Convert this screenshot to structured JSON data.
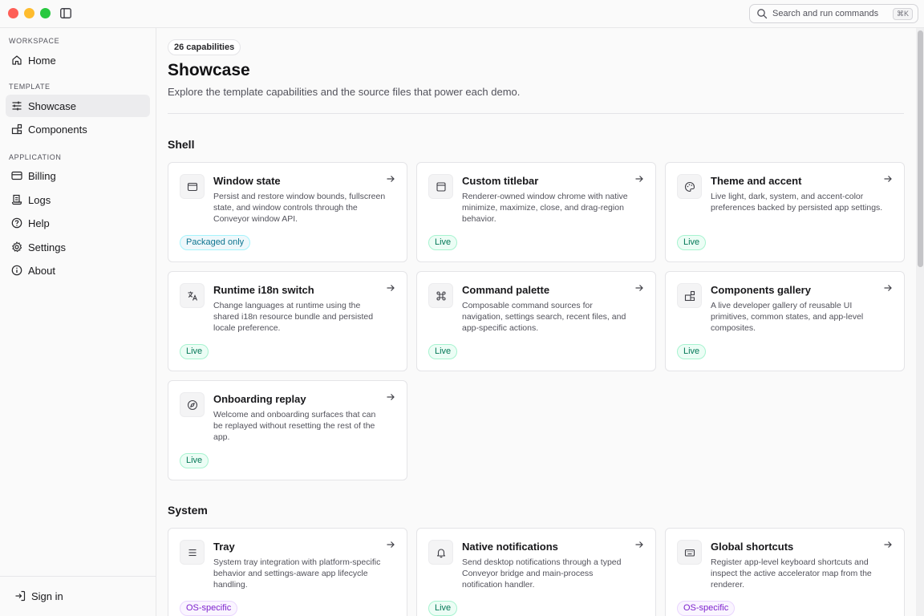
{
  "titlebar": {
    "search_placeholder": "Search and run commands",
    "search_shortcut": "⌘K"
  },
  "sidebar": {
    "sections": [
      {
        "label": "WORKSPACE"
      },
      {
        "label": "TEMPLATE"
      },
      {
        "label": "APPLICATION"
      }
    ],
    "items": [
      {
        "label": "Home",
        "icon": "home-icon"
      },
      {
        "label": "Showcase",
        "icon": "sliders-icon",
        "active": true
      },
      {
        "label": "Components",
        "icon": "blocks-icon"
      },
      {
        "label": "Billing",
        "icon": "credit-card-icon"
      },
      {
        "label": "Logs",
        "icon": "logs-icon"
      },
      {
        "label": "Help",
        "icon": "help-circle-icon"
      },
      {
        "label": "Settings",
        "icon": "gear-icon"
      },
      {
        "label": "About",
        "icon": "info-icon"
      }
    ],
    "footer": {
      "signin_label": "Sign in"
    }
  },
  "main": {
    "count_badge": "26 capabilities",
    "title": "Showcase",
    "subtitle": "Explore the template capabilities and the source files that power each demo.",
    "groups": [
      {
        "title": "Shell",
        "cards": [
          {
            "title": "Window state",
            "desc": "Persist and restore window bounds, fullscreen state, and window controls through the Conveyor window API.",
            "badge": "Packaged only",
            "badge_kind": "packaged",
            "icon": "window-icon"
          },
          {
            "title": "Custom titlebar",
            "desc": "Renderer-owned window chrome with native minimize, maximize, close, and drag-region behavior.",
            "badge": "Live",
            "badge_kind": "live",
            "icon": "titlebar-icon"
          },
          {
            "title": "Theme and accent",
            "desc": "Live light, dark, system, and accent-color preferences backed by persisted app settings.",
            "badge": "Live",
            "badge_kind": "live",
            "icon": "palette-icon"
          },
          {
            "title": "Runtime i18n switch",
            "desc": "Change languages at runtime using the shared i18n resource bundle and persisted locale preference.",
            "badge": "Live",
            "badge_kind": "live",
            "icon": "languages-icon"
          },
          {
            "title": "Command palette",
            "desc": "Composable command sources for navigation, settings search, recent files, and app-specific actions.",
            "badge": "Live",
            "badge_kind": "live",
            "icon": "command-icon"
          },
          {
            "title": "Components gallery",
            "desc": "A live developer gallery of reusable UI primitives, common states, and app-level composites.",
            "badge": "Live",
            "badge_kind": "live",
            "icon": "blocks-icon"
          },
          {
            "title": "Onboarding replay",
            "desc": "Welcome and onboarding surfaces that can be replayed without resetting the rest of the app.",
            "badge": "Live",
            "badge_kind": "live",
            "icon": "compass-icon"
          }
        ]
      },
      {
        "title": "System",
        "cards": [
          {
            "title": "Tray",
            "desc": "System tray integration with platform-specific behavior and settings-aware app lifecycle handling.",
            "badge": "OS-specific",
            "badge_kind": "os",
            "icon": "menu-lines-icon"
          },
          {
            "title": "Native notifications",
            "desc": "Send desktop notifications through a typed Conveyor bridge and main-process notification handler.",
            "badge": "Live",
            "badge_kind": "live",
            "icon": "bell-icon"
          },
          {
            "title": "Global shortcuts",
            "desc": "Register app-level keyboard shortcuts and inspect the active accelerator map from the renderer.",
            "badge": "OS-specific",
            "badge_kind": "os",
            "icon": "keyboard-icon"
          }
        ]
      }
    ]
  },
  "colors": {
    "live_badge": "#047857",
    "packaged_badge": "#0e7490",
    "os_badge": "#7e22ce",
    "traffic_red": "#fe5f57",
    "traffic_yellow": "#febc2e",
    "traffic_green": "#28c840"
  }
}
